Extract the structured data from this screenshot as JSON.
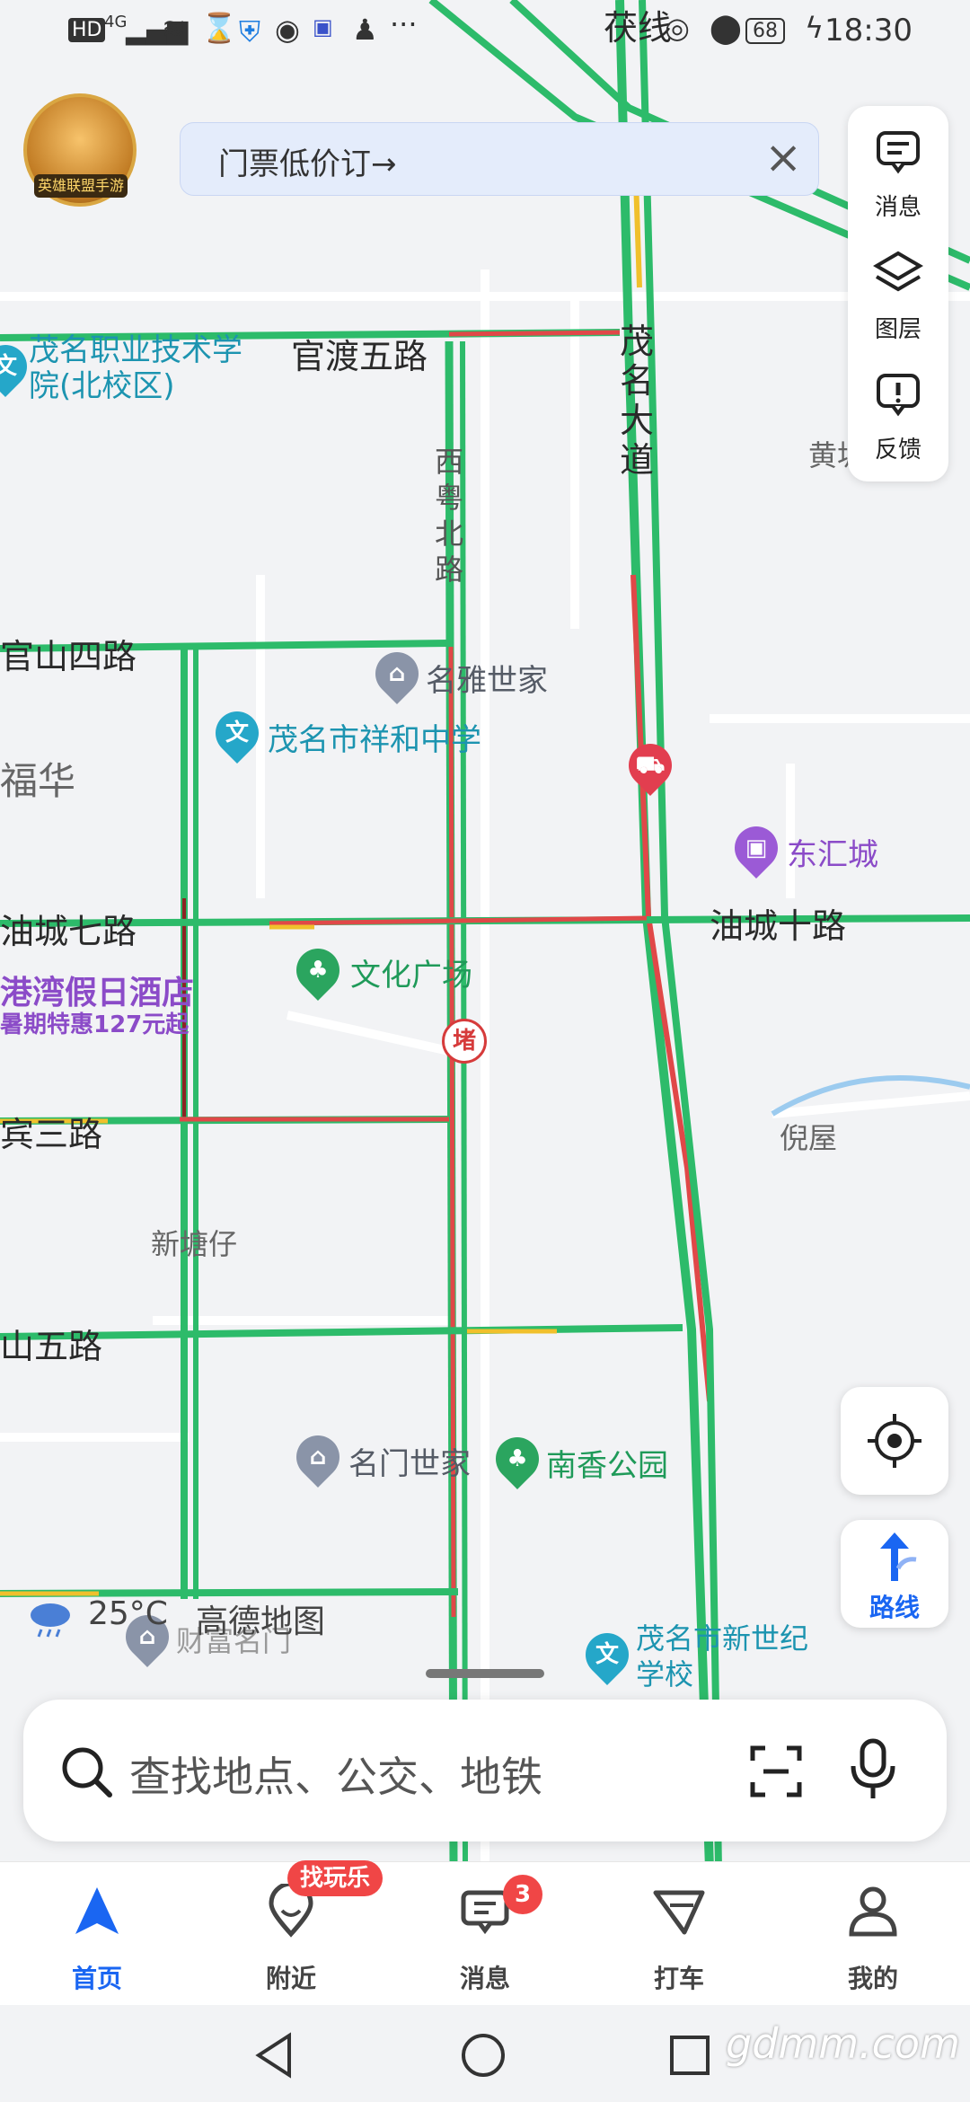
{
  "status_bar": {
    "left_icons": [
      "HD",
      "4G"
    ],
    "battery": "68",
    "time": "18:30"
  },
  "banner": {
    "text": "门票低价订→",
    "close": "×"
  },
  "avatar": {
    "badge": "英雄联盟手游"
  },
  "side_panel": {
    "items": [
      {
        "label": "消息",
        "icon": "message-icon"
      },
      {
        "label": "图层",
        "icon": "layers-icon"
      },
      {
        "label": "反馈",
        "icon": "feedback-icon"
      }
    ]
  },
  "map": {
    "roads": {
      "guandu5": "官渡五路",
      "maoming_avenue": "茂名大道",
      "xiyue_north": "西粤北路",
      "guanshan4": "官山四路",
      "youcheng7": "油城七路",
      "youcheng10": "油城十路",
      "bin3": "宾三路",
      "shan5": "山五路",
      "top_line": "茯线",
      "fuhua": "福华"
    },
    "pois": {
      "vocational": "茂名职业技术学院(北校区)",
      "mingya": "名雅世家",
      "xianghe": "茂名市祥和中学",
      "donghui": "东汇城",
      "culture_square": "文化广场",
      "hotel": "港湾假日酒店",
      "hotel_promo": "暑期特惠127元起",
      "jam_badge": "堵",
      "nixiu": "倪屋",
      "xintangzai": "新塘仔",
      "mingmen": "名门世家",
      "nanxiang": "南香公园",
      "caifu": "财富名门",
      "xinshiji": "茂名市新世纪学校",
      "huang": "黄坡"
    },
    "weather": {
      "temp": "25°C",
      "brand": "高德地图"
    }
  },
  "route_button": {
    "label": "路线"
  },
  "search": {
    "placeholder": "查找地点、公交、地铁"
  },
  "tabs": [
    {
      "label": "首页",
      "icon": "home-navigation-icon",
      "active": true
    },
    {
      "label": "附近",
      "icon": "location-pin-icon",
      "pill": "找玩乐"
    },
    {
      "label": "消息",
      "icon": "message-icon",
      "badge": "3"
    },
    {
      "label": "打车",
      "icon": "taxi-icon"
    },
    {
      "label": "我的",
      "icon": "profile-icon"
    }
  ],
  "watermark": "gdmm.com",
  "colors": {
    "accent": "#1a66f2",
    "road_green": "#2dbb6a",
    "road_red": "#e04848",
    "road_yellow": "#f0c02c"
  }
}
